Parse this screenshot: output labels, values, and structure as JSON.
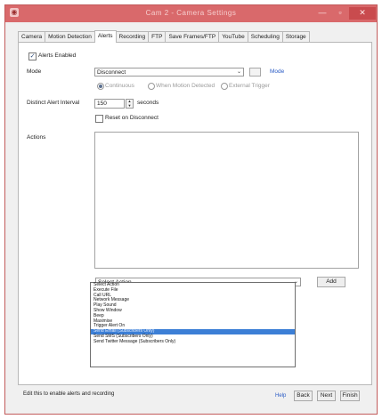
{
  "window": {
    "title": "Cam 2 - Camera Settings",
    "app_icon": "camera-app-icon",
    "controls": [
      "minimize-icon",
      "maximize-icon",
      "close-icon"
    ]
  },
  "tabs": [
    {
      "label": "Camera",
      "active": false
    },
    {
      "label": "Motion Detection",
      "active": false
    },
    {
      "label": "Alerts",
      "active": true
    },
    {
      "label": "Recording",
      "active": false
    },
    {
      "label": "FTP",
      "active": false
    },
    {
      "label": "Save Frames/FTP",
      "active": false
    },
    {
      "label": "YouTube",
      "active": false
    },
    {
      "label": "Scheduling",
      "active": false
    },
    {
      "label": "Storage",
      "active": false
    }
  ],
  "alerts": {
    "enabled_label": "Alerts Enabled",
    "enabled": true,
    "mode_label": "Mode",
    "mode_value": "Disconnect",
    "mode_link": "Mode",
    "radio_options": [
      "Continuous",
      "When Motion Detected",
      "External Trigger"
    ],
    "radio_selected": 0,
    "interval_label": "Distinct Alert Interval",
    "interval_value": "150",
    "interval_unit": "seconds",
    "reset_label": "Reset on Disconnect",
    "reset_checked": false,
    "actions_label": "Actions"
  },
  "action_select": {
    "value": "Select Action",
    "add_label": "Add",
    "options": [
      "Select Action",
      "Execute File",
      "Call URL",
      "Network Message",
      "Play Sound",
      "Show Window",
      "Beep",
      "Maximise",
      "Trigger Alert On",
      "Send Email (Subscribers Only)",
      "Send SMS (Subscribers Only)",
      "Send Twitter Message (Subscribers Only)"
    ],
    "highlighted_index": 9
  },
  "footer": {
    "status_text": "Edit this to enable alerts and recording",
    "help_link": "Help",
    "buttons": [
      "Back",
      "Next",
      "Finish"
    ]
  },
  "colors": {
    "titlebar": "#d9696b",
    "selection": "#3c7fd6",
    "link": "#2a5bc5"
  }
}
